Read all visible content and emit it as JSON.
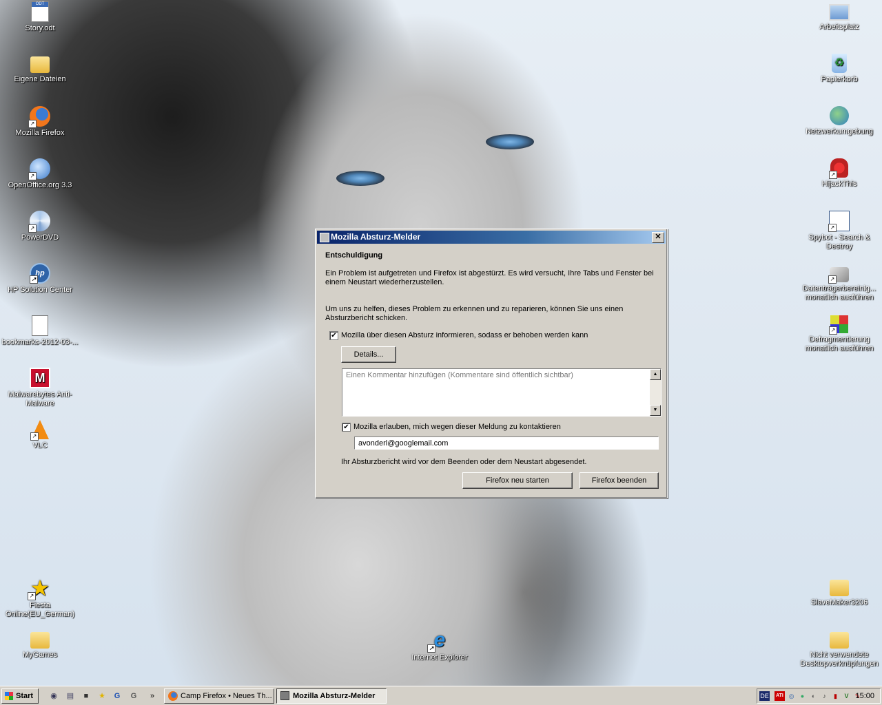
{
  "desktop": {
    "left_icons": [
      {
        "label": "Story.odt",
        "icon": "odt-document-icon"
      },
      {
        "label": "Eigene Dateien",
        "icon": "folder-documents-icon"
      },
      {
        "label": "Mozilla Firefox",
        "icon": "firefox-icon"
      },
      {
        "label": "OpenOffice.org 3.3",
        "icon": "openoffice-icon"
      },
      {
        "label": "PowerDVD",
        "icon": "powerdvd-icon"
      },
      {
        "label": "HP Solution Center",
        "icon": "hp-icon"
      },
      {
        "label": "bookmarks-2012-03-...",
        "icon": "json-file-icon"
      },
      {
        "label": "Malwarebytes Anti-Malware",
        "icon": "malwarebytes-icon"
      },
      {
        "label": "VLC",
        "icon": "vlc-icon"
      },
      {
        "label": "Fiesta Online(EU_German)",
        "icon": "fiesta-star-icon"
      },
      {
        "label": "MyGames",
        "icon": "folder-icon"
      }
    ],
    "right_icons": [
      {
        "label": "Arbeitsplatz",
        "icon": "computer-icon"
      },
      {
        "label": "Papierkorb",
        "icon": "recycle-bin-icon"
      },
      {
        "label": "Netzwerkumgebung",
        "icon": "network-icon"
      },
      {
        "label": "HijackThis",
        "icon": "hijackthis-icon"
      },
      {
        "label": "Spybot - Search & Destroy",
        "icon": "spybot-icon"
      },
      {
        "label": "Datenträgerbereinig... monatlich ausführen",
        "icon": "disk-cleanup-icon"
      },
      {
        "label": "Defragmentierung monatlich ausführen",
        "icon": "defrag-icon"
      },
      {
        "label": "SlaveMaker3206",
        "icon": "folder-icon"
      },
      {
        "label": "Nicht verwendete Desktopverknüpfungen",
        "icon": "folder-icon"
      }
    ],
    "center_icon": {
      "label": "Internet Explorer",
      "icon": "internet-explorer-icon"
    }
  },
  "dialog": {
    "title": "Mozilla Absturz-Melder",
    "heading": "Entschuldigung",
    "message1": "Ein Problem ist aufgetreten und Firefox ist abgestürzt. Es wird versucht, Ihre Tabs und Fenster bei einem Neustart wiederherzustellen.",
    "message2": "Um uns zu helfen, dieses Problem zu erkennen und zu reparieren, können Sie uns einen Absturzbericht schicken.",
    "report_checkbox_label": "Mozilla über diesen Absturz informieren, sodass er behoben werden kann",
    "report_checked": true,
    "details_button": "Details...",
    "comment_placeholder": "Einen Kommentar hinzufügen (Kommentare sind öffentlich sichtbar)",
    "contact_checkbox_label": "Mozilla erlauben, mich wegen dieser Meldung zu kontaktieren",
    "contact_checked": true,
    "email_value": "avonderl@googlemail.com",
    "footer_note": "Ihr Absturzbericht wird vor dem Beenden oder dem Neustart abgesendet.",
    "restart_button": "Firefox neu starten",
    "quit_button": "Firefox beenden",
    "check_mark": "✔",
    "close_glyph": "✕"
  },
  "taskbar": {
    "start_label": "Start",
    "more_glyph": "»",
    "tasks": [
      {
        "label": "Camp Firefox • Neues Th...",
        "active": false
      },
      {
        "label": "Mozilla Absturz-Melder",
        "active": true
      }
    ],
    "language": "DE",
    "clock": "15:00"
  }
}
